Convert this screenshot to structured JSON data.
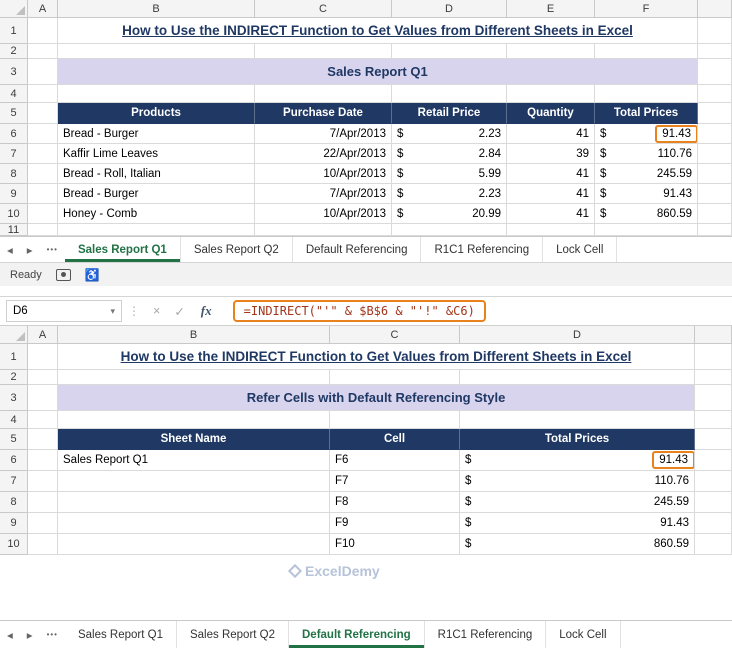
{
  "title": "How to Use the INDIRECT Function to Get Values from Different Sheets in Excel",
  "colors": {
    "header_navy": "#1F3864",
    "banner_lavender": "#D8D4EE",
    "title_blue": "#1F3864",
    "highlight_orange": "#E8821C",
    "active_tab_green": "#217346",
    "formula_text": "#A0351B"
  },
  "glyphs": {
    "nav_left": "◂",
    "nav_right": "▸",
    "overflow": "•••",
    "chevron_down": "▾",
    "cancel": "×",
    "enter": "✓",
    "fx": "fx",
    "handle": "⋮",
    "accessibility": "♿"
  },
  "top": {
    "col_headers": [
      "A",
      "B",
      "C",
      "D",
      "E",
      "F"
    ],
    "row_headers": [
      "1",
      "2",
      "3",
      "4",
      "5",
      "6",
      "7",
      "8",
      "9",
      "10",
      "11"
    ],
    "banner": "Sales Report Q1",
    "table": {
      "headers": [
        "Products",
        "Purchase Date",
        "Retail Price",
        "Quantity",
        "Total Prices"
      ],
      "rows": [
        {
          "product": "Bread - Burger",
          "date": "7/Apr/2013",
          "cur_retail": "$",
          "retail": "2.23",
          "qty": "41",
          "cur_total": "$",
          "total": "91.43"
        },
        {
          "product": "Kaffir Lime Leaves",
          "date": "22/Apr/2013",
          "cur_retail": "$",
          "retail": "2.84",
          "qty": "39",
          "cur_total": "$",
          "total": "110.76"
        },
        {
          "product": "Bread - Roll, Italian",
          "date": "10/Apr/2013",
          "cur_retail": "$",
          "retail": "5.99",
          "qty": "41",
          "cur_total": "$",
          "total": "245.59"
        },
        {
          "product": "Bread - Burger",
          "date": "7/Apr/2013",
          "cur_retail": "$",
          "retail": "2.23",
          "qty": "41",
          "cur_total": "$",
          "total": "91.43"
        },
        {
          "product": "Honey - Comb",
          "date": "10/Apr/2013",
          "cur_retail": "$",
          "retail": "20.99",
          "qty": "41",
          "cur_total": "$",
          "total": "860.59"
        }
      ]
    },
    "tabs": [
      "Sales Report Q1",
      "Sales Report Q2",
      "Default Referencing",
      "R1C1 Referencing",
      "Lock Cell"
    ],
    "active_tab": "Sales Report Q1",
    "status": "Ready"
  },
  "formula_bar": {
    "name_box": "D6",
    "formula": "=INDIRECT(\"'\" & $B$6 & \"'!\" &C6)"
  },
  "bottom": {
    "col_headers": [
      "A",
      "B",
      "C",
      "D"
    ],
    "row_headers": [
      "1",
      "2",
      "3",
      "4",
      "5",
      "6",
      "7",
      "8",
      "9",
      "10"
    ],
    "banner": "Refer Cells with Default Referencing Style",
    "table": {
      "headers": [
        "Sheet Name",
        "Cell",
        "Total Prices"
      ],
      "rows": [
        {
          "sheet": "Sales Report Q1",
          "cell": "F6",
          "cur": "$",
          "total": "91.43"
        },
        {
          "sheet": "",
          "cell": "F7",
          "cur": "$",
          "total": "110.76"
        },
        {
          "sheet": "",
          "cell": "F8",
          "cur": "$",
          "total": "245.59"
        },
        {
          "sheet": "",
          "cell": "F9",
          "cur": "$",
          "total": "91.43"
        },
        {
          "sheet": "",
          "cell": "F10",
          "cur": "$",
          "total": "860.59"
        }
      ]
    },
    "tabs": [
      "Sales Report Q1",
      "Sales Report Q2",
      "Default Referencing",
      "R1C1 Referencing",
      "Lock Cell"
    ],
    "active_tab": "Default Referencing",
    "watermark": "ExcelDemy"
  }
}
